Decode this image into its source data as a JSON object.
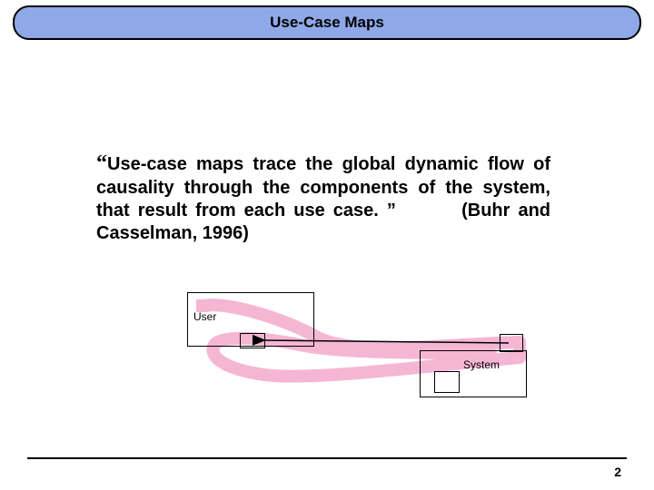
{
  "header": {
    "title": "Use-Case Maps"
  },
  "quote": {
    "open": "“",
    "body": "Use-case maps trace the global dynamic flow of causality through the components of the system, that result from each use case. ”",
    "citation": "(Buhr and Casselman, 1996)"
  },
  "diagram": {
    "user_label": "User",
    "system_label": "System",
    "path_color": "#f5b6d4",
    "arrow_color": "#000000"
  },
  "footer": {
    "page_number": "2"
  }
}
